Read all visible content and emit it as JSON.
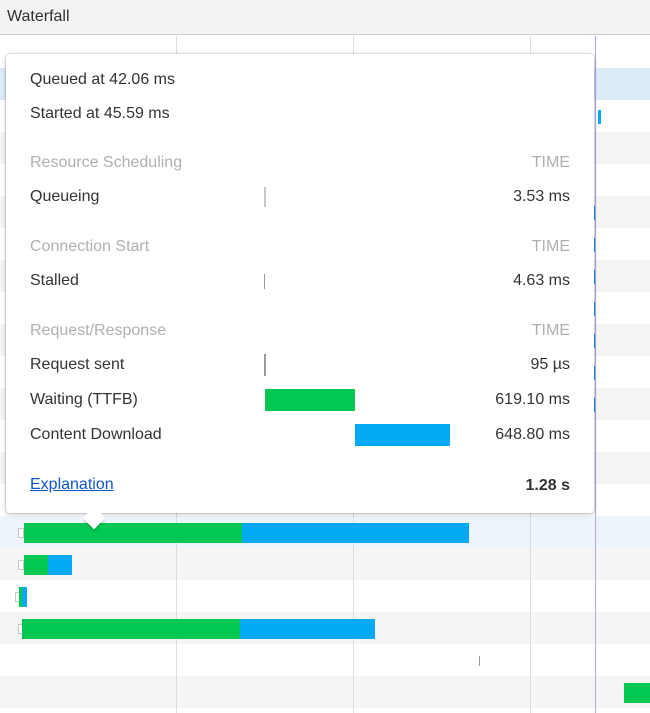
{
  "header": {
    "title": "Waterfall"
  },
  "tooltip": {
    "queued": "Queued at 42.06 ms",
    "started": "Started at 45.59 ms",
    "sections": [
      {
        "title": "Resource Scheduling",
        "time_label": "TIME",
        "items": [
          {
            "label": "Queueing",
            "value": "3.53 ms"
          }
        ]
      },
      {
        "title": "Connection Start",
        "time_label": "TIME",
        "items": [
          {
            "label": "Stalled",
            "value": "4.63 ms"
          }
        ]
      },
      {
        "title": "Request/Response",
        "time_label": "TIME",
        "items": [
          {
            "label": "Request sent",
            "value": "95 µs"
          },
          {
            "label": "Waiting (TTFB)",
            "value": "619.10 ms",
            "color": "#00c853"
          },
          {
            "label": "Content Download",
            "value": "648.80 ms",
            "color": "#03a9f4"
          }
        ]
      }
    ],
    "explanation": "Explanation",
    "total": "1.28 s"
  },
  "colors": {
    "waiting": "#00c853",
    "download": "#03a9f4",
    "link": "#1155cc",
    "selected_row": "#dcebfa"
  }
}
